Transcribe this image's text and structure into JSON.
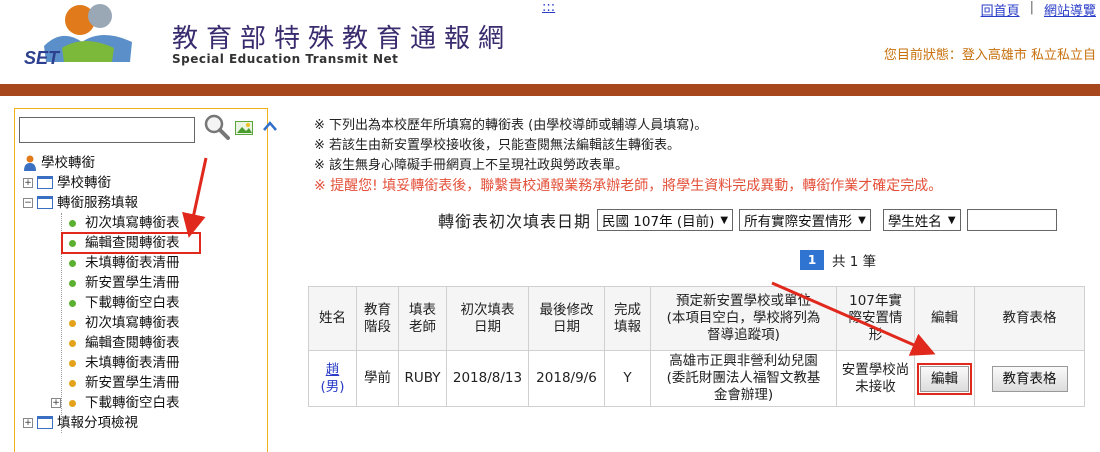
{
  "header": {
    "title": "教育部特殊教育通報網",
    "subtitle": "Special Education Transmit Net",
    "logo_text": "SET",
    "skip_link": ":::",
    "links": [
      "回首頁",
      "網站導覽"
    ],
    "link_separator": "|",
    "status": "您目前狀態：登入高雄市 私立私立自"
  },
  "sidebar": {
    "search_placeholder": "",
    "tree": [
      {
        "label": "學校轉銜",
        "kind": "person"
      },
      {
        "label": "學校轉銜",
        "kind": "folder",
        "expander": "+"
      },
      {
        "label": "轉銜服務填報",
        "kind": "folder",
        "expander": "−"
      },
      {
        "label": "初次填寫轉銜表",
        "kind": "green"
      },
      {
        "label": "編輯查閱轉銜表",
        "kind": "green",
        "highlighted": true
      },
      {
        "label": "未填轉銜表清冊",
        "kind": "green"
      },
      {
        "label": "新安置學生清冊",
        "kind": "green"
      },
      {
        "label": "下載轉銜空白表",
        "kind": "green"
      },
      {
        "label": "初次填寫轉銜表",
        "kind": "yellow"
      },
      {
        "label": "編輯查閱轉銜表",
        "kind": "yellow"
      },
      {
        "label": "未填轉銜表清冊",
        "kind": "yellow"
      },
      {
        "label": "新安置學生清冊",
        "kind": "yellow"
      },
      {
        "label": "下載轉銜空白表",
        "kind": "yellow",
        "expander": "+"
      },
      {
        "label": "填報分項檢視",
        "kind": "folder",
        "expander": "+"
      }
    ]
  },
  "notes": [
    "※ 下列出為本校歷年所填寫的轉銜表 (由學校導師或輔導人員填寫)。",
    "※ 若該生由新安置學校接收後，只能查閱無法編輯該生轉銜表。",
    "※ 該生無身心障礙手冊網頁上不呈現社政與勞政表單。",
    "※ 提醒您! 填妥轉銜表後，聯繫貴校通報業務承辦老師，將學生資料完成異動，轉銜作業才確定完成。"
  ],
  "filter": {
    "label": "轉銜表初次填表日期",
    "year_select": "民國 107年 (目前)",
    "placement_select": "所有實際安置情形",
    "name_select": "學生姓名",
    "name_value": ""
  },
  "pager": {
    "current_page": "1",
    "total_text": "共 1 筆"
  },
  "table": {
    "headers": [
      "姓名",
      "教育階段",
      "填表老師",
      "初次填表日期",
      "最後修改日期",
      "完成填報",
      "預定新安置學校或單位(本項目空白，學校將列為督導追蹤項)",
      "107年實際安置情形",
      "編輯",
      "教育表格"
    ],
    "header_lines": [
      [
        "姓名"
      ],
      [
        "教育",
        "階段"
      ],
      [
        "填表",
        "老師"
      ],
      [
        "初次填表",
        "日期"
      ],
      [
        "最後修改",
        "日期"
      ],
      [
        "完成",
        "填報"
      ],
      [
        "預定新安置學校或單位",
        "(本項目空白，學校將列為",
        "督導追蹤項)"
      ],
      [
        "107年實",
        "際安置情",
        "形"
      ],
      [
        "編輯"
      ],
      [
        "教育表格"
      ]
    ],
    "rows": [
      {
        "name": "趙",
        "gender": "(男)",
        "stage": "學前",
        "teacher": "RUBY",
        "first_date": "2018/8/13",
        "last_date": "2018/9/6",
        "completed": "Y",
        "school_lines": [
          "高雄市正興非營利幼兒園",
          "(委託財團法人福智文教基",
          "金會辦理)"
        ],
        "placement_lines": [
          "安置學校尚",
          "未接收"
        ],
        "edit_label": "編輯",
        "forms_label": "教育表格"
      }
    ]
  },
  "colors": {
    "brand_bar": "#a7471d",
    "status": "#c7700c",
    "highlight": "#e0281c",
    "page_badge": "#2f74d0",
    "reminder": "#e3503a"
  }
}
